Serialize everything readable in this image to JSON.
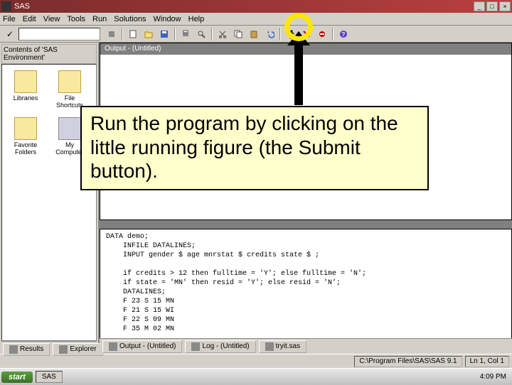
{
  "titlebar": {
    "app_name": "SAS"
  },
  "menu": {
    "file": "File",
    "edit": "Edit",
    "view": "View",
    "tools": "Tools",
    "run": "Run",
    "solutions": "Solutions",
    "window": "Window",
    "help": "Help"
  },
  "toolbar": {
    "check": "✓",
    "new": "new-icon",
    "open": "open-icon",
    "save": "save-icon",
    "print": "print-icon",
    "preview": "preview-icon",
    "cut": "cut-icon",
    "copy": "copy-icon",
    "paste": "paste-icon",
    "undo": "undo-icon",
    "submit": "submit-icon",
    "clear": "clear-icon",
    "break": "break-icon",
    "help": "help-icon"
  },
  "explorer": {
    "title": "Explorer",
    "header": "Contents of 'SAS Environment'",
    "items": [
      {
        "label": "Libraries",
        "icon": "libraries"
      },
      {
        "label": "File Shortcuts",
        "icon": "file-shortcuts"
      },
      {
        "label": "Favorite Folders",
        "icon": "favorite"
      },
      {
        "label": "My Computer",
        "icon": "computer"
      }
    ]
  },
  "windows": {
    "output_title": "Output - (Untitled)",
    "editor_title": "tryit.sas"
  },
  "editor_code": "DATA demo;\n    INFILE DATALINES;\n    INPUT gender $ age mnrstat $ credits state $ ;\n\n    if credits > 12 then fulltime = 'Y'; else fulltime = 'N';\n    if state = 'MN' then resid = 'Y'; else resid = 'N';\n    DATALINES;\n    F 23 S 15 MN\n    F 21 S 15 WI\n    F 22 S 09 MN\n    F 35 M 02 MN",
  "left_tabs": {
    "results": "Results",
    "explorer": "Explorer"
  },
  "bottom_tabs": {
    "output": "Output - (Untitled)",
    "log": "Log - (Untitled)",
    "editor": "tryit.sas"
  },
  "status": {
    "path": "C:\\Program Files\\SAS\\SAS 9.1",
    "pos": "Ln 1, Col 1"
  },
  "taskbar": {
    "start": "start",
    "task1": "SAS",
    "time": "4:09 PM"
  },
  "callout": {
    "text": "Run the program by clicking on the little running figure (the Submit button)."
  }
}
